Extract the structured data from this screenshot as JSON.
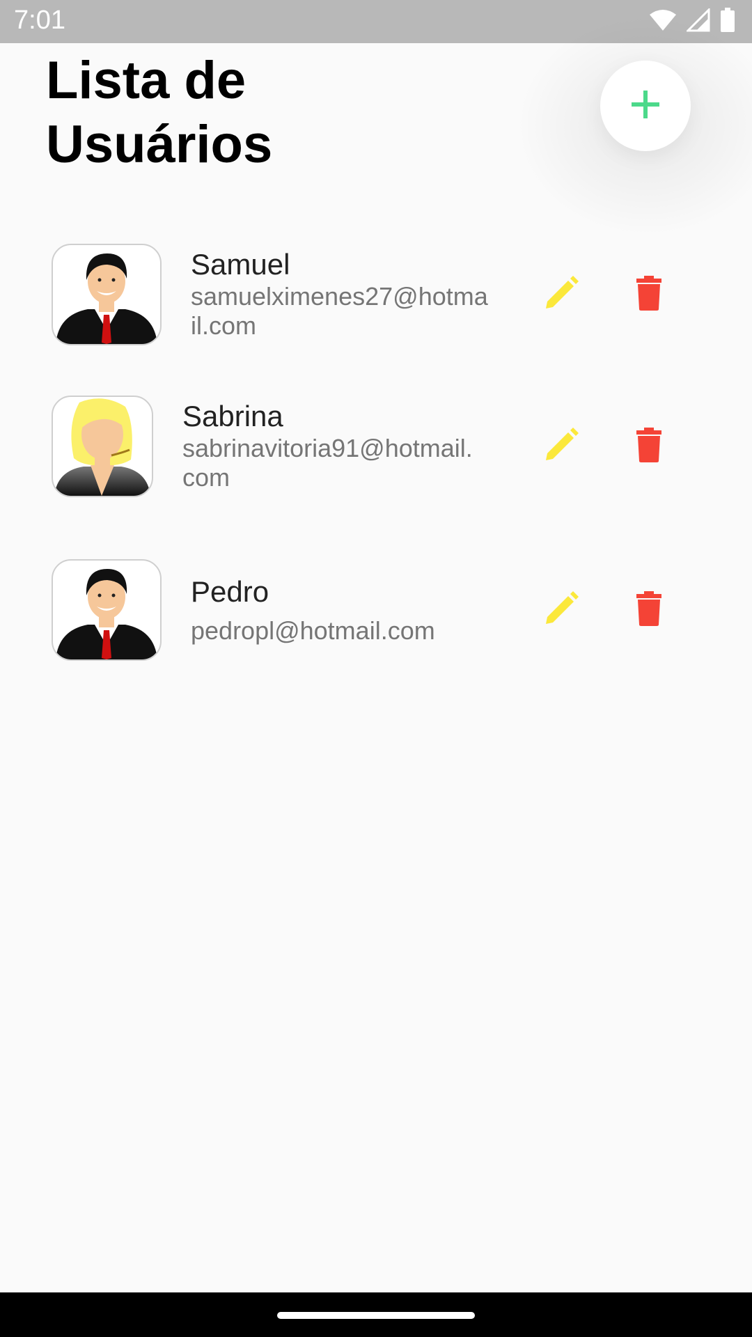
{
  "status_bar": {
    "time": "7:01",
    "icons": [
      "wifi-icon",
      "signal-icon",
      "battery-icon"
    ]
  },
  "header": {
    "title": "Lista de Usuários"
  },
  "fab": {
    "icon": "plus-icon",
    "color": "#4cd98a"
  },
  "users": [
    {
      "name": "Samuel",
      "email": "samuelximenes27@hotmail.com",
      "avatar": "male-avatar"
    },
    {
      "name": "Sabrina",
      "email": "sabrinavitoria91@hotmail.com",
      "avatar": "female-avatar"
    },
    {
      "name": "Pedro",
      "email": "pedropl@hotmail.com",
      "avatar": "male-avatar"
    }
  ],
  "actions": {
    "edit_icon": "pencil-icon",
    "edit_color": "#fbe83b",
    "delete_icon": "trash-icon",
    "delete_color": "#f44336"
  }
}
